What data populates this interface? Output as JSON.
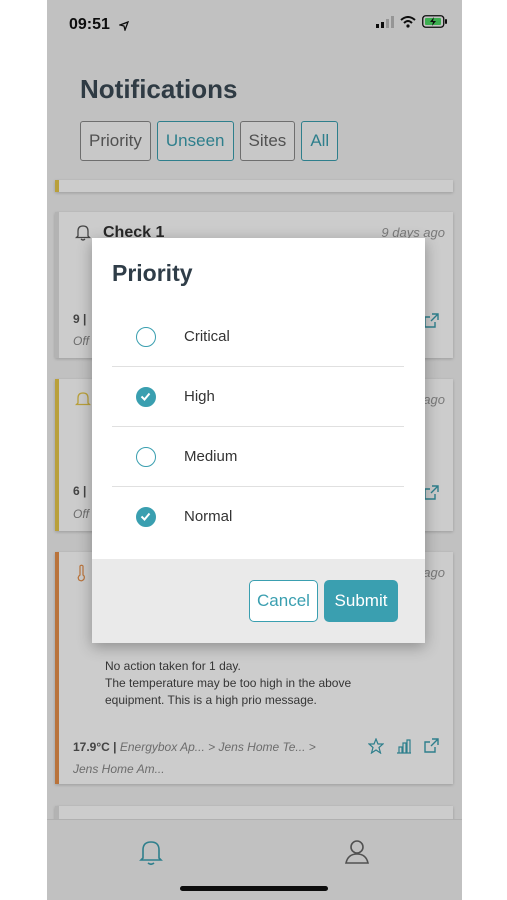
{
  "status_bar": {
    "time": "09:51",
    "location_icon": "location-arrow-icon",
    "signal_icon": "signal-icon",
    "wifi_icon": "wifi-icon",
    "battery_icon": "battery-charging-icon"
  },
  "page": {
    "title": "Notifications"
  },
  "filters": [
    {
      "label": "Priority",
      "active": false
    },
    {
      "label": "Unseen",
      "active": true
    },
    {
      "label": "Sites",
      "active": false
    },
    {
      "label": "All",
      "active": true
    }
  ],
  "cards": [
    {
      "title": "Check 1",
      "date": "9 days ago",
      "foot_value": "9 |",
      "foot_sub": "Off",
      "accent": "#e0e0e0"
    },
    {
      "title": "",
      "date": "ago",
      "foot_value": "6 |",
      "foot_sub": "Off",
      "accent": "#e8c94a"
    },
    {
      "title": "",
      "date": "ago",
      "body": "No action taken for 1 day.\nThe temperature may be too high in the above equipment. This is a high prio message.",
      "foot_value": "17.9°C |",
      "foot_path": "Energybox Ap... > Jens Home Te... >",
      "foot_path2": "Jens Home Am...",
      "accent": "#e8904a"
    }
  ],
  "dialog": {
    "title": "Priority",
    "options": [
      {
        "label": "Critical",
        "checked": false
      },
      {
        "label": "High",
        "checked": true
      },
      {
        "label": "Medium",
        "checked": false
      },
      {
        "label": "Normal",
        "checked": true
      }
    ],
    "cancel_label": "Cancel",
    "submit_label": "Submit"
  },
  "tabbar": {
    "items": [
      {
        "icon": "bell-icon"
      },
      {
        "icon": "user-icon"
      }
    ]
  },
  "colors": {
    "accent": "#3a9fb0",
    "title": "#3b4a55"
  }
}
